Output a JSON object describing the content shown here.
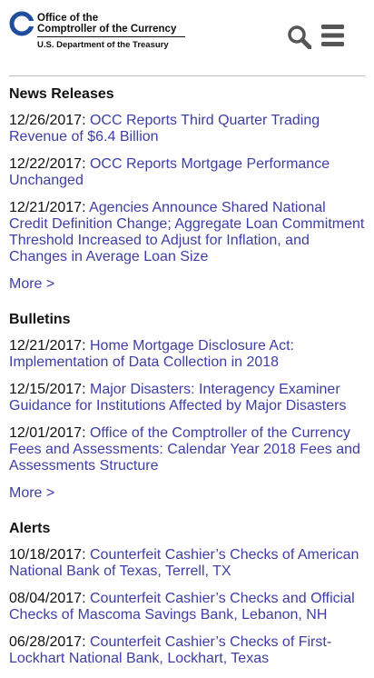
{
  "header": {
    "logo_line1": "Office of the",
    "logo_line2": "Comptroller of the Currency",
    "logo_line3": "U.S. Department of the Treasury",
    "search_icon": "search-icon",
    "menu_icon": "hamburger-menu-icon"
  },
  "colors": {
    "link": "#3e3ea8",
    "logo_blue": "#1e4e9c",
    "icon_gray": "#555555"
  },
  "sections": [
    {
      "title": "News Releases",
      "items": [
        {
          "date": "12/26/2017:",
          "text": "OCC Reports Third Quarter Trading Revenue of $6.4 Billion"
        },
        {
          "date": "12/22/2017:",
          "text": "OCC Reports Mortgage Performance Unchanged"
        },
        {
          "date": "12/21/2017:",
          "text": "Agencies Announce Shared National Credit Definition Change; Aggregate Loan Commitment Threshold Increased to Adjust for Inflation, and Changes in Average Loan Size"
        }
      ],
      "more": "More >"
    },
    {
      "title": "Bulletins",
      "items": [
        {
          "date": "12/21/2017:",
          "text": "Home Mortgage Disclosure Act: Implementation of Data Collection in 2018"
        },
        {
          "date": "12/15/2017:",
          "text": "Major Disasters: Interagency Examiner Guidance for Institutions Affected by Major Disasters"
        },
        {
          "date": "12/01/2017:",
          "text": "Office of the Comptroller of the Currency Fees and Assessments: Calendar Year 2018 Fees and Assessments Structure"
        }
      ],
      "more": "More >"
    },
    {
      "title": "Alerts",
      "items": [
        {
          "date": "10/18/2017:",
          "text": "Counterfeit Cashier’s Checks of American National Bank of Texas, Terrell, TX"
        },
        {
          "date": "08/04/2017:",
          "text": "Counterfeit Cashier’s Checks and Official Checks of Mascoma Savings Bank, Lebanon, NH"
        },
        {
          "date": "06/28/2017:",
          "text": "Counterfeit Cashier’s Checks of First-Lockhart National Bank, Lockhart, Texas"
        }
      ]
    }
  ]
}
